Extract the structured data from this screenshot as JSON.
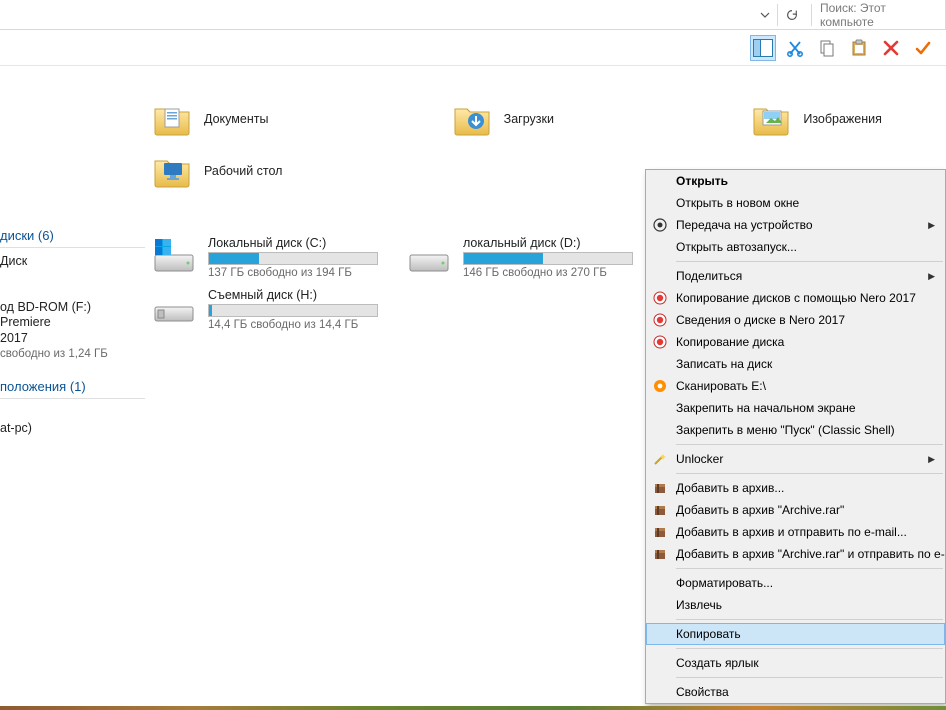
{
  "addr": {
    "search_placeholder": "Поиск: Этот компьюте"
  },
  "left": {
    "drives_header": "диски (6)",
    "disk_label": "Диск",
    "bdrom_line1": "од BD-ROM (F:) Premiere",
    "bdrom_line2": "2017",
    "bdrom_sub": "свободно из 1,24 ГБ",
    "locations_header": "положения (1)",
    "host": "at-pc)"
  },
  "folders": [
    {
      "label": "Документы"
    },
    {
      "label": "Загрузки"
    },
    {
      "label": "Изображения"
    },
    {
      "label": "Рабочий стол"
    }
  ],
  "drives": [
    {
      "label": "Локальный диск (C:)",
      "sub": "137 ГБ свободно из 194 ГБ",
      "fill": 30,
      "variant": "win"
    },
    {
      "label": "локальный диск  (D:)",
      "sub": "146 ГБ свободно из 270 ГБ",
      "fill": 47,
      "variant": "hdd"
    },
    {
      "label": "Съемный диск (H:)",
      "sub": "14,4 ГБ свободно из 14,4 ГБ",
      "fill": 2,
      "variant": "usb"
    }
  ],
  "ctx": {
    "groups": [
      [
        {
          "label": "Открыть",
          "bold": true
        },
        {
          "label": "Открыть в новом окне"
        },
        {
          "label": "Передача на устройство",
          "icon": "broadcast",
          "arrow": true
        },
        {
          "label": "Открыть автозапуск..."
        }
      ],
      [
        {
          "label": "Поделиться",
          "arrow": true
        },
        {
          "label": "Копирование дисков с помощью Nero 2017",
          "icon": "nero-red"
        },
        {
          "label": "Сведения о диске в Nero 2017",
          "icon": "nero-red"
        },
        {
          "label": "Копирование диска",
          "icon": "nero-red"
        },
        {
          "label": "Записать на диск"
        },
        {
          "label": "Сканировать E:\\",
          "icon": "avast"
        },
        {
          "label": "Закрепить на начальном экране"
        },
        {
          "label": "Закрепить в меню \"Пуск\" (Classic Shell)"
        }
      ],
      [
        {
          "label": "Unlocker",
          "icon": "wand",
          "arrow": true
        }
      ],
      [
        {
          "label": "Добавить в архив...",
          "icon": "rar"
        },
        {
          "label": "Добавить в архив \"Archive.rar\"",
          "icon": "rar"
        },
        {
          "label": "Добавить в архив и отправить по e-mail...",
          "icon": "rar"
        },
        {
          "label": "Добавить в архив \"Archive.rar\" и отправить по e-",
          "icon": "rar"
        }
      ],
      [
        {
          "label": "Форматировать..."
        },
        {
          "label": "Извлечь"
        }
      ],
      [
        {
          "label": "Копировать",
          "hover": true
        }
      ],
      [
        {
          "label": "Создать ярлык"
        }
      ],
      [
        {
          "label": "Свойства"
        }
      ]
    ]
  }
}
